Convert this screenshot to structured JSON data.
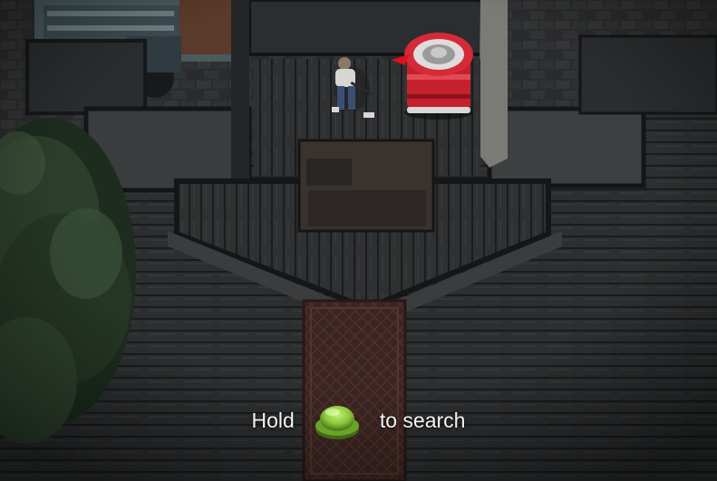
{
  "hud": {
    "prompt": {
      "prefix": "Hold",
      "button_icon": "green-round-button-icon",
      "suffix": "to search"
    },
    "interact_marker_icon": "red-arrow-marker-icon"
  },
  "scene": {
    "objects": {
      "player": "player-character",
      "container": "red-metal-supply-canister",
      "vehicle": "rusty-pickup-truck",
      "tree": "pine-tree",
      "table": "wooden-table",
      "rug": "patterned-floor-rug"
    }
  },
  "colors": {
    "button_green": "#8cc83a",
    "container_red": "#c4202e",
    "marker_red": "#e0101a",
    "prompt_text": "#f2f2f2"
  }
}
